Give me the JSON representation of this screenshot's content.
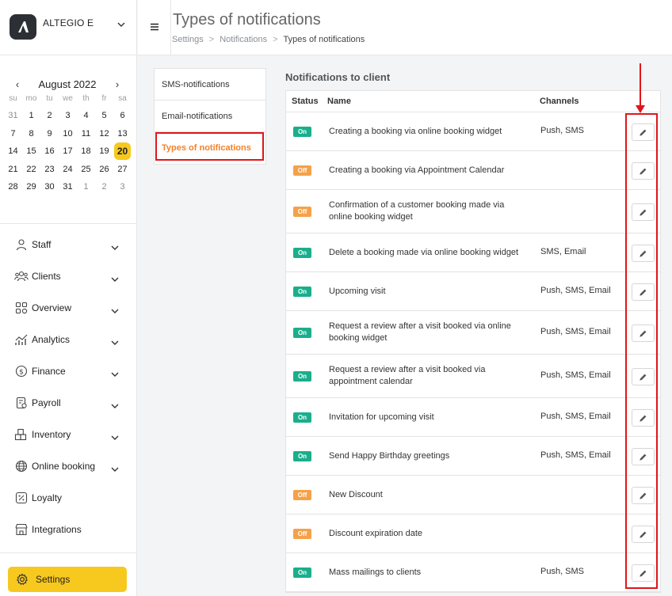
{
  "brand": {
    "name": "ALTEGIO E"
  },
  "header": {
    "title": "Types of notifications",
    "breadcrumb": [
      "Settings",
      "Notifications",
      "Types of notifications"
    ],
    "sep": ">"
  },
  "calendar": {
    "title": "August 2022",
    "prev": "‹",
    "next": "›",
    "dows": [
      "su",
      "mo",
      "tu",
      "we",
      "th",
      "fr",
      "sa"
    ],
    "weeks": [
      [
        "31",
        "1",
        "2",
        "3",
        "4",
        "5",
        "6"
      ],
      [
        "7",
        "8",
        "9",
        "10",
        "11",
        "12",
        "13"
      ],
      [
        "14",
        "15",
        "16",
        "17",
        "18",
        "19",
        "20"
      ],
      [
        "21",
        "22",
        "23",
        "24",
        "25",
        "26",
        "27"
      ],
      [
        "28",
        "29",
        "30",
        "31",
        "1",
        "2",
        "3"
      ]
    ],
    "today": "20"
  },
  "nav": {
    "items": [
      {
        "label": "Staff",
        "icon": "user-icon"
      },
      {
        "label": "Clients",
        "icon": "users-icon"
      },
      {
        "label": "Overview",
        "icon": "grid-icon"
      },
      {
        "label": "Analytics",
        "icon": "analytics-icon"
      },
      {
        "label": "Finance",
        "icon": "dollar-icon"
      },
      {
        "label": "Payroll",
        "icon": "payroll-icon"
      },
      {
        "label": "Inventory",
        "icon": "boxes-icon"
      },
      {
        "label": "Online booking",
        "icon": "globe-icon"
      },
      {
        "label": "Loyalty",
        "icon": "percent-icon"
      },
      {
        "label": "Integrations",
        "icon": "store-icon"
      }
    ],
    "settings_label": "Settings"
  },
  "submenu": {
    "items": [
      "SMS-notifications",
      "Email-notifications",
      "Types of notifications"
    ],
    "active": 2
  },
  "section_title": "Notifications to client",
  "table": {
    "headers": {
      "status": "Status",
      "name": "Name",
      "channels": "Channels"
    },
    "rows": [
      {
        "status": "On",
        "name": "Creating a booking via online booking widget",
        "channels": "Push, SMS"
      },
      {
        "status": "Off",
        "name": "Creating a booking via Appointment Calendar",
        "channels": ""
      },
      {
        "status": "Off",
        "name": "Confirmation of a customer booking made via online booking widget",
        "channels": ""
      },
      {
        "status": "On",
        "name": "Delete a booking made via online booking widget",
        "channels": "SMS, Email"
      },
      {
        "status": "On",
        "name": "Upcoming visit",
        "channels": "Push, SMS, Email"
      },
      {
        "status": "On",
        "name": "Request a review after a visit booked via online booking widget",
        "channels": "Push, SMS, Email"
      },
      {
        "status": "On",
        "name": "Request a review after a visit booked via appointment calendar",
        "channels": "Push, SMS, Email"
      },
      {
        "status": "On",
        "name": "Invitation for upcoming visit",
        "channels": "Push, SMS, Email"
      },
      {
        "status": "On",
        "name": "Send Happy Birthday greetings",
        "channels": "Push, SMS, Email"
      },
      {
        "status": "Off",
        "name": "New Discount",
        "channels": ""
      },
      {
        "status": "Off",
        "name": "Discount expiration date",
        "channels": ""
      },
      {
        "status": "On",
        "name": "Mass mailings to clients",
        "channels": "Push, SMS"
      }
    ]
  },
  "colors": {
    "accent": "#f7c81e",
    "on": "#1aae8c",
    "off": "#f5a14a",
    "highlight": "#e0151b",
    "active_link": "#f2822c"
  }
}
